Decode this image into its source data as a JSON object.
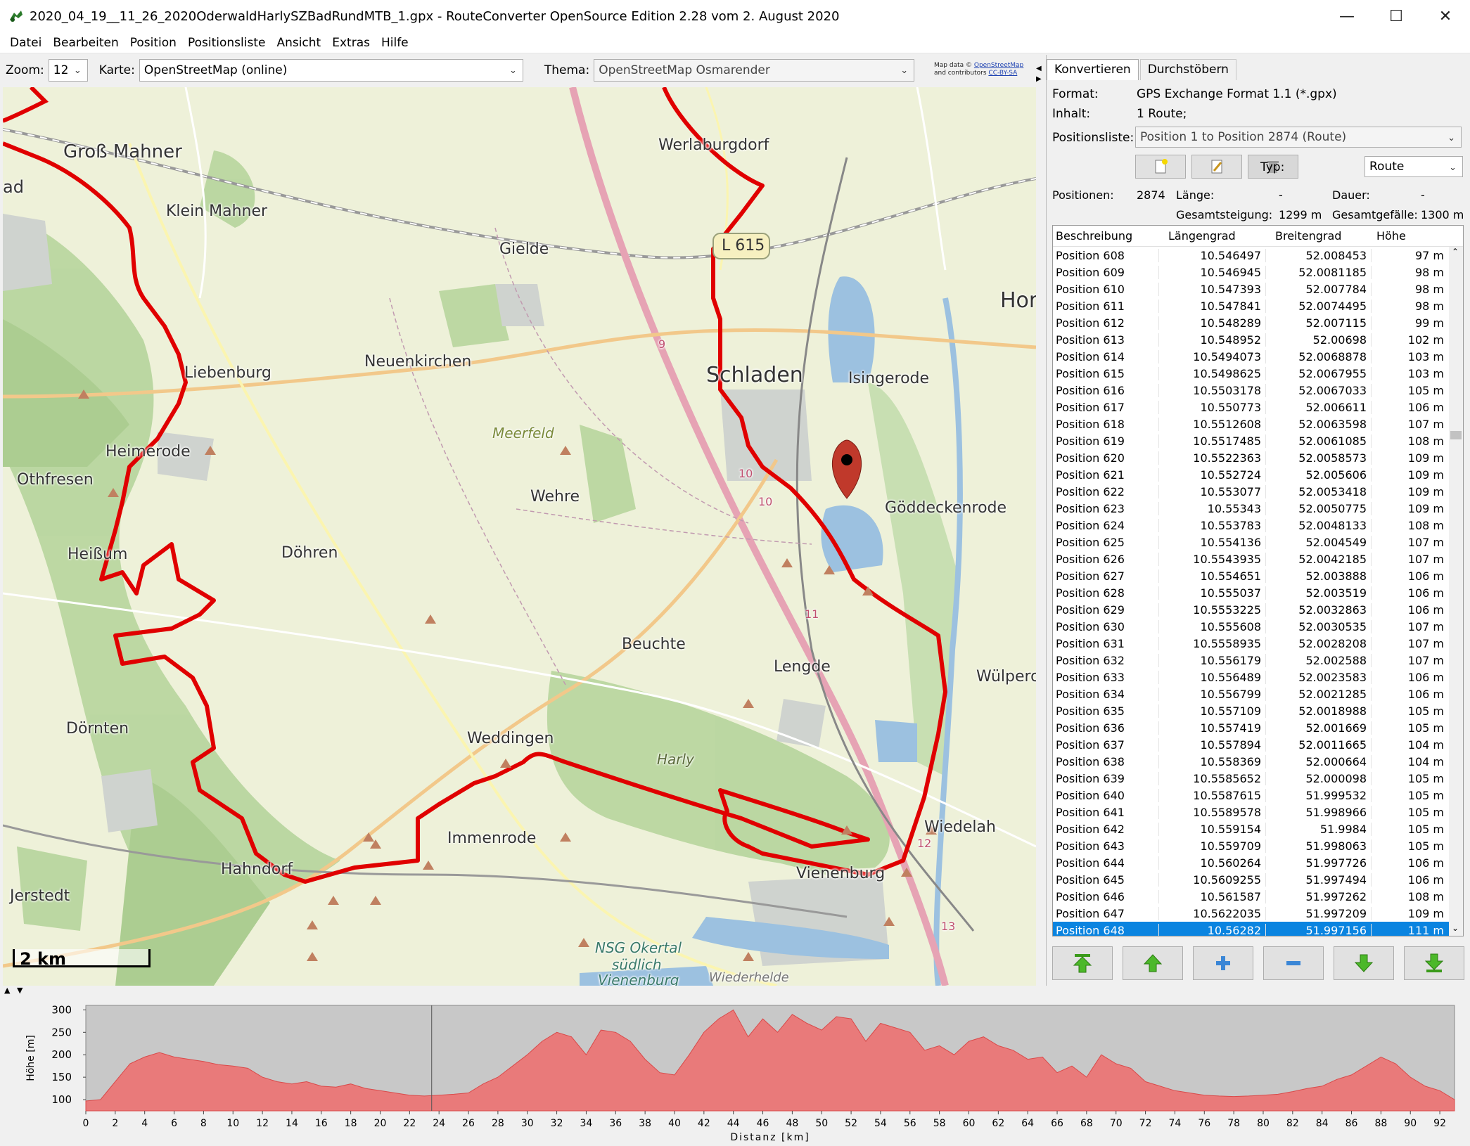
{
  "window": {
    "title": "2020_04_19__11_26_2020OderwaldHarlySZBadRundMTB_1.gpx - RouteConverter OpenSource Edition 2.28 vom 2. August 2020",
    "minimize": "—",
    "maximize": "☐",
    "close": "✕"
  },
  "menu": [
    "Datei",
    "Bearbeiten",
    "Position",
    "Positionsliste",
    "Ansicht",
    "Extras",
    "Hilfe"
  ],
  "maptoolbar": {
    "zoom_label": "Zoom:",
    "zoom_value": "12",
    "karte_label": "Karte:",
    "karte_value": "OpenStreetMap (online)",
    "thema_label": "Thema:",
    "thema_value": "OpenStreetMap Osmarender",
    "attrib1": "Map data ©",
    "attrib1_link": "OpenStreetMap",
    "attrib2": "and contributors",
    "attrib2_link": "CC-BY-SA"
  },
  "map": {
    "places": [
      "Groß Mahner",
      "Klein Mahner",
      "Werlaburgdorf",
      "Gielde",
      "L 615",
      "Schladen",
      "Isingerode",
      "Liebenburg",
      "Neuenkirchen",
      "Meerfeld",
      "Heimerode",
      "Othfresen",
      "Wehre",
      "Göddeckenrode",
      "Heißum",
      "Döhren",
      "Beuchte",
      "Lengde",
      "Wülperode",
      "Dörnten",
      "Weddingen",
      "Harly",
      "Immenrode",
      "Wiedelah",
      "Vienenburg",
      "Hahndorf",
      "Jerstedt",
      "NSG Okertal",
      "südlich",
      "Vienenburg",
      "Wiederhelde",
      "Hor",
      "ad"
    ],
    "road_numbers": [
      "9",
      "10",
      "10",
      "11",
      "12",
      "13"
    ],
    "scale": "2 km"
  },
  "panel": {
    "tabs": [
      "Konvertieren",
      "Durchstöbern"
    ],
    "format_label": "Format:",
    "format_value": "GPS Exchange Format 1.1 (*.gpx)",
    "inhalt_label": "Inhalt:",
    "inhalt_value": "1 Route;",
    "pl_label": "Positionsliste:",
    "pl_value": "Position 1 to Position 2874 (Route)",
    "typ_label": "Typ:",
    "typ_value": "Route",
    "pos_label": "Positionen:",
    "pos_value": "2874",
    "laenge_label": "Länge:",
    "laenge_value": "-",
    "dauer_label": "Dauer:",
    "dauer_value": "-",
    "steig_label": "Gesamtsteigung:",
    "steig_value": "1299 m",
    "gef_label": "Gesamtgefälle:",
    "gef_value": "1300 m"
  },
  "table": {
    "headers": [
      "Beschreibung",
      "Längengrad",
      "Breitengrad",
      "Höhe"
    ],
    "rows": [
      [
        "Position 608",
        "10.546497",
        "52.008453",
        "97 m"
      ],
      [
        "Position 609",
        "10.546945",
        "52.0081185",
        "98 m"
      ],
      [
        "Position 610",
        "10.547393",
        "52.007784",
        "98 m"
      ],
      [
        "Position 611",
        "10.547841",
        "52.0074495",
        "98 m"
      ],
      [
        "Position 612",
        "10.548289",
        "52.007115",
        "99 m"
      ],
      [
        "Position 613",
        "10.548952",
        "52.00698",
        "102 m"
      ],
      [
        "Position 614",
        "10.5494073",
        "52.0068878",
        "103 m"
      ],
      [
        "Position 615",
        "10.5498625",
        "52.0067955",
        "103 m"
      ],
      [
        "Position 616",
        "10.5503178",
        "52.0067033",
        "105 m"
      ],
      [
        "Position 617",
        "10.550773",
        "52.006611",
        "106 m"
      ],
      [
        "Position 618",
        "10.5512608",
        "52.0063598",
        "107 m"
      ],
      [
        "Position 619",
        "10.5517485",
        "52.0061085",
        "108 m"
      ],
      [
        "Position 620",
        "10.5522363",
        "52.0058573",
        "109 m"
      ],
      [
        "Position 621",
        "10.552724",
        "52.005606",
        "109 m"
      ],
      [
        "Position 622",
        "10.553077",
        "52.0053418",
        "109 m"
      ],
      [
        "Position 623",
        "10.55343",
        "52.0050775",
        "109 m"
      ],
      [
        "Position 624",
        "10.553783",
        "52.0048133",
        "108 m"
      ],
      [
        "Position 625",
        "10.554136",
        "52.004549",
        "107 m"
      ],
      [
        "Position 626",
        "10.5543935",
        "52.0042185",
        "107 m"
      ],
      [
        "Position 627",
        "10.554651",
        "52.003888",
        "106 m"
      ],
      [
        "Position 628",
        "10.555037",
        "52.003519",
        "106 m"
      ],
      [
        "Position 629",
        "10.5553225",
        "52.0032863",
        "106 m"
      ],
      [
        "Position 630",
        "10.555608",
        "52.0030535",
        "107 m"
      ],
      [
        "Position 631",
        "10.5558935",
        "52.0028208",
        "107 m"
      ],
      [
        "Position 632",
        "10.556179",
        "52.002588",
        "107 m"
      ],
      [
        "Position 633",
        "10.556489",
        "52.0023583",
        "106 m"
      ],
      [
        "Position 634",
        "10.556799",
        "52.0021285",
        "106 m"
      ],
      [
        "Position 635",
        "10.557109",
        "52.0018988",
        "105 m"
      ],
      [
        "Position 636",
        "10.557419",
        "52.001669",
        "105 m"
      ],
      [
        "Position 637",
        "10.557894",
        "52.0011665",
        "104 m"
      ],
      [
        "Position 638",
        "10.558369",
        "52.000664",
        "104 m"
      ],
      [
        "Position 639",
        "10.5585652",
        "52.000098",
        "105 m"
      ],
      [
        "Position 640",
        "10.5587615",
        "51.999532",
        "105 m"
      ],
      [
        "Position 641",
        "10.5589578",
        "51.998966",
        "105 m"
      ],
      [
        "Position 642",
        "10.559154",
        "51.9984",
        "105 m"
      ],
      [
        "Position 643",
        "10.559709",
        "51.998063",
        "105 m"
      ],
      [
        "Position 644",
        "10.560264",
        "51.997726",
        "106 m"
      ],
      [
        "Position 645",
        "10.5609255",
        "51.997494",
        "106 m"
      ],
      [
        "Position 646",
        "10.561587",
        "51.997262",
        "108 m"
      ],
      [
        "Position 647",
        "10.5622035",
        "51.997209",
        "109 m"
      ],
      [
        "Position 648",
        "10.56282",
        "51.997156",
        "111 m"
      ]
    ],
    "selected": 40
  },
  "chart_data": {
    "type": "area",
    "ylabel": "Höhe [m]",
    "xlabel": "Distanz [km]",
    "xlim": [
      0,
      93
    ],
    "ylim": [
      75,
      310
    ],
    "yticks": [
      100,
      150,
      200,
      250,
      300
    ],
    "xticks": [
      0,
      2,
      4,
      6,
      8,
      10,
      12,
      14,
      16,
      18,
      20,
      22,
      24,
      26,
      28,
      30,
      32,
      34,
      36,
      38,
      40,
      42,
      44,
      46,
      48,
      50,
      52,
      54,
      56,
      58,
      60,
      62,
      64,
      66,
      68,
      70,
      72,
      74,
      76,
      78,
      80,
      82,
      84,
      86,
      88,
      90,
      92
    ],
    "x": [
      0,
      1,
      2,
      3,
      4,
      5,
      6,
      7,
      8,
      9,
      10,
      11,
      12,
      13,
      14,
      15,
      16,
      17,
      18,
      19,
      20,
      21,
      22,
      23,
      24,
      25,
      26,
      27,
      28,
      29,
      30,
      31,
      32,
      33,
      34,
      35,
      36,
      37,
      38,
      39,
      40,
      41,
      42,
      43,
      44,
      45,
      46,
      47,
      48,
      49,
      50,
      51,
      52,
      53,
      54,
      55,
      56,
      57,
      58,
      59,
      60,
      61,
      62,
      63,
      64,
      65,
      66,
      67,
      68,
      69,
      70,
      71,
      72,
      73,
      74,
      75,
      76,
      77,
      78,
      79,
      80,
      81,
      82,
      83,
      84,
      85,
      86,
      87,
      88,
      89,
      90,
      91,
      92,
      93
    ],
    "values": [
      97,
      100,
      140,
      180,
      195,
      205,
      195,
      190,
      185,
      178,
      175,
      170,
      150,
      140,
      135,
      140,
      130,
      128,
      135,
      125,
      120,
      115,
      110,
      108,
      110,
      112,
      115,
      135,
      150,
      175,
      200,
      230,
      250,
      240,
      200,
      255,
      250,
      230,
      190,
      160,
      155,
      200,
      250,
      280,
      300,
      240,
      280,
      250,
      290,
      270,
      255,
      285,
      280,
      230,
      270,
      260,
      250,
      210,
      220,
      200,
      230,
      240,
      220,
      210,
      190,
      195,
      160,
      175,
      150,
      200,
      180,
      170,
      140,
      130,
      120,
      115,
      110,
      108,
      107,
      108,
      110,
      112,
      118,
      125,
      130,
      145,
      155,
      175,
      195,
      180,
      150,
      130,
      120,
      100
    ],
    "cursor_x": 23.5
  }
}
